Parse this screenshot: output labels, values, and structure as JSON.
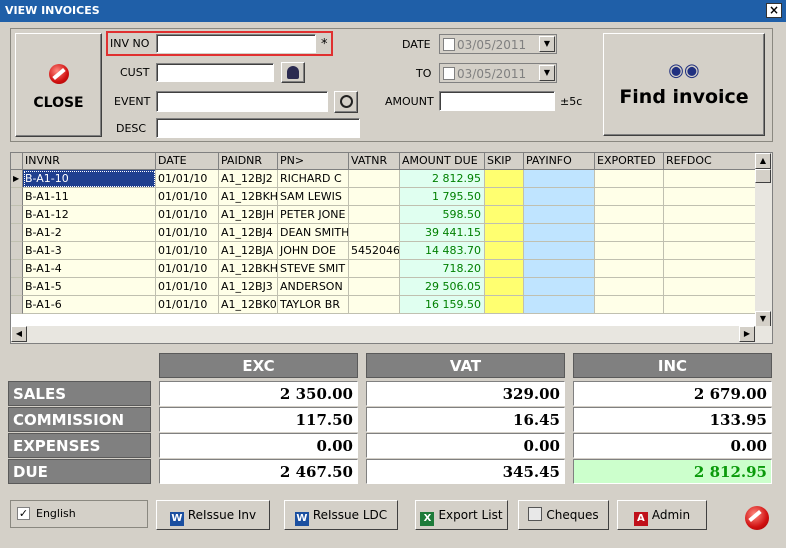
{
  "window": {
    "title": "VIEW INVOICES",
    "close_glyph": "×"
  },
  "buttons": {
    "close_label": "CLOSE",
    "find_label": "Find invoice",
    "reissue_inv": "ReIssue Inv",
    "reissue_ldc": "ReIssue LDC",
    "export_list": "Export List",
    "cheques": "Cheques",
    "admin": "Admin"
  },
  "filters": {
    "inv_no_label": "INV NO",
    "inv_no_value": "",
    "required_mark": "*",
    "cust_label": "CUST",
    "cust_value": "",
    "event_label": "EVENT",
    "event_value": "",
    "desc_label": "DESC",
    "desc_value": "",
    "date_label": "DATE",
    "date_from": "03/05/2011",
    "to_label": "TO",
    "date_to": "03/05/2011",
    "amount_label": "AMOUNT",
    "amount_value": "",
    "amount_tolerance": "±5c"
  },
  "grid": {
    "columns": [
      "INVNR",
      "DATE",
      "PAIDNR",
      "PN>",
      "VATNR",
      "AMOUNT DUE",
      "SKIP",
      "PAYINFO",
      "EXPORTED",
      "REFDOC"
    ],
    "rows": [
      {
        "invnr": "B-A1-10",
        "date": "01/01/10",
        "paidnr": "A1_12BJ2",
        "pn": "RICHARD C",
        "vatnr": "",
        "amount": "2 812.95"
      },
      {
        "invnr": "B-A1-11",
        "date": "01/01/10",
        "paidnr": "A1_12BKH",
        "pn": "SAM LEWIS",
        "vatnr": "",
        "amount": "1 795.50"
      },
      {
        "invnr": "B-A1-12",
        "date": "01/01/10",
        "paidnr": "A1_12BJH",
        "pn": "PETER JONE",
        "vatnr": "",
        "amount": "598.50"
      },
      {
        "invnr": "B-A1-2",
        "date": "01/01/10",
        "paidnr": "A1_12BJ4",
        "pn": "DEAN SMITH",
        "vatnr": "",
        "amount": "39 441.15"
      },
      {
        "invnr": "B-A1-3",
        "date": "01/01/10",
        "paidnr": "A1_12BJA",
        "pn": "JOHN DOE",
        "vatnr": "5452046",
        "amount": "14 483.70"
      },
      {
        "invnr": "B-A1-4",
        "date": "01/01/10",
        "paidnr": "A1_12BKH",
        "pn": "STEVE SMIT",
        "vatnr": "",
        "amount": "718.20"
      },
      {
        "invnr": "B-A1-5",
        "date": "01/01/10",
        "paidnr": "A1_12BJ3",
        "pn": "ANDERSON",
        "vatnr": "",
        "amount": "29 506.05"
      },
      {
        "invnr": "B-A1-6",
        "date": "01/01/10",
        "paidnr": "A1_12BK0",
        "pn": "TAYLOR BR",
        "vatnr": "",
        "amount": "16 159.50"
      }
    ]
  },
  "totals": {
    "columns": [
      "EXC",
      "VAT",
      "INC"
    ],
    "rows": [
      {
        "label": "SALES",
        "exc": "2 350.00",
        "vat": "329.00",
        "inc": "2 679.00"
      },
      {
        "label": "COMMISSION",
        "exc": "117.50",
        "vat": "16.45",
        "inc": "133.95"
      },
      {
        "label": "EXPENSES",
        "exc": "0.00",
        "vat": "0.00",
        "inc": "0.00"
      },
      {
        "label": "DUE",
        "exc": "2 467.50",
        "vat": "345.45",
        "inc": "2 812.95"
      }
    ]
  },
  "footer": {
    "language_label": "English",
    "language_checked": true
  },
  "icons": {
    "close": "no-entry-icon",
    "cust_search": "person-search-icon",
    "event_timer": "stopwatch-icon",
    "find": "binoculars-icon",
    "word": "word-icon",
    "excel": "excel-icon",
    "printer": "printer-icon",
    "admin": "admin-icon",
    "stop": "stop-icon"
  },
  "colors": {
    "title_bar": "#1f5fa8",
    "amount_text": "#008000",
    "skip_col": "#ffff70",
    "payinfo_col": "#bfe4ff",
    "due_inc_bg": "#ccffcc",
    "highlight_border": "#e03030"
  }
}
